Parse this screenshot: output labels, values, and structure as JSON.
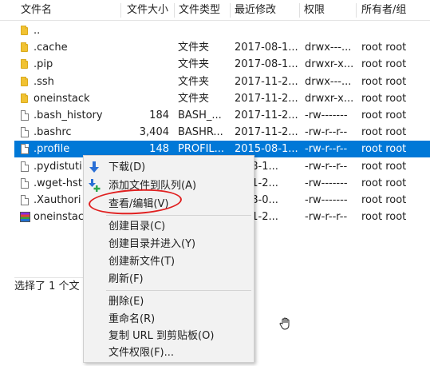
{
  "columns": [
    "文件名",
    "文件大小",
    "文件类型",
    "最近修改",
    "权限",
    "所有者/组"
  ],
  "files": [
    {
      "name": "..",
      "size": "",
      "type": "",
      "modified": "",
      "perms": "",
      "owner": "",
      "icon": "folder-icon"
    },
    {
      "name": ".cache",
      "size": "",
      "type": "文件夹",
      "modified": "2017-08-1...",
      "perms": "drwx---...",
      "owner": "root root",
      "icon": "folder-icon"
    },
    {
      "name": ".pip",
      "size": "",
      "type": "文件夹",
      "modified": "2017-08-1...",
      "perms": "drwxr-x...",
      "owner": "root root",
      "icon": "folder-icon"
    },
    {
      "name": ".ssh",
      "size": "",
      "type": "文件夹",
      "modified": "2017-11-2...",
      "perms": "drwx---...",
      "owner": "root root",
      "icon": "folder-icon"
    },
    {
      "name": "oneinstack",
      "size": "",
      "type": "文件夹",
      "modified": "2017-11-2...",
      "perms": "drwxr-x...",
      "owner": "root root",
      "icon": "folder-icon"
    },
    {
      "name": ".bash_history",
      "size": "184",
      "type": "BASH_...",
      "modified": "2017-11-2...",
      "perms": "-rw-------",
      "owner": "root root",
      "icon": "file-icon"
    },
    {
      "name": ".bashrc",
      "size": "3,404",
      "type": "BASHR...",
      "modified": "2017-11-2...",
      "perms": "-rw-r--r--",
      "owner": "root root",
      "icon": "file-icon"
    },
    {
      "name": ".profile",
      "size": "148",
      "type": "PROFIL...",
      "modified": "2015-08-1...",
      "perms": "-rw-r--r--",
      "owner": "root root",
      "icon": "file-icon",
      "selected": true
    },
    {
      "name": ".pydistuti",
      "size": "",
      "type": "",
      "modified": "7-08-1...",
      "perms": "-rw-r--r--",
      "owner": "root root",
      "icon": "file-icon"
    },
    {
      "name": ".wget-hst",
      "size": "",
      "type": "",
      "modified": "7-11-2...",
      "perms": "-rw-------",
      "owner": "root root",
      "icon": "file-icon"
    },
    {
      "name": ".Xauthori",
      "size": "",
      "type": "",
      "modified": "0-08-0...",
      "perms": "-rw-------",
      "owner": "root root",
      "icon": "file-icon"
    },
    {
      "name": "oneinstac",
      "size": "",
      "type": "",
      "modified": "7-11-2...",
      "perms": "-rw-r--r--",
      "owner": "root root",
      "icon": "archive-icon"
    }
  ],
  "status_text": "选择了 1 个文",
  "context_menu": {
    "download": "下载(D)",
    "add_to_queue": "添加文件到队列(A)",
    "view_edit": "查看/编辑(V)",
    "create_dir": "创建目录(C)",
    "create_dir_enter": "创建目录并进入(Y)",
    "create_file": "创建新文件(T)",
    "refresh": "刷新(F)",
    "delete": "删除(E)",
    "rename": "重命名(R)",
    "copy_url": "复制 URL 到剪贴板(O)",
    "file_perms": "文件权限(F)..."
  },
  "colors": {
    "selection": "#0078d7",
    "annotation": "#e02020",
    "download_arrow": "#2a6fd6",
    "add_plus": "#2fa84f"
  }
}
